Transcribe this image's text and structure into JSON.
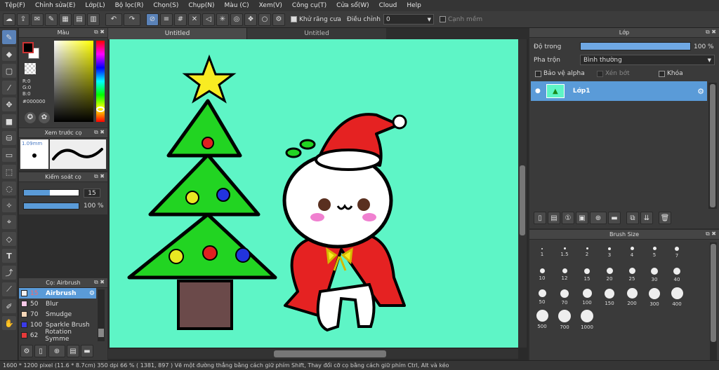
{
  "menu": [
    "Tệp(F)",
    "Chỉnh sửa(E)",
    "Lớp(L)",
    "Bộ lọc(R)",
    "Chọn(S)",
    "Chụp(N)",
    "Màu (C)",
    "Xem(V)",
    "Công cụ(T)",
    "Cửa sổ(W)",
    "Cloud",
    "Help"
  ],
  "toolbar": {
    "anti_alias_label": "Khử răng cưa",
    "adjust_label": "Điều chỉnh",
    "adjust_value": "0",
    "smooth_edge_label": "Cạnh mềm"
  },
  "color_panel": {
    "title": "Màu",
    "r": "R:0",
    "g": "G:0",
    "b": "B:0",
    "hex": "#000000"
  },
  "brush_preview": {
    "title": "Xem trước cọ",
    "size": "1.09mm"
  },
  "brush_control": {
    "title": "Kiểm soát cọ",
    "size_value": "15",
    "opacity_value": "100 %",
    "size_fraction": 0.48,
    "opacity_fraction": 1.0
  },
  "brush_list": {
    "title": "Cọ: Airbrush",
    "items": [
      {
        "size": "15",
        "name": "Airbrush",
        "color": "#f2f2f2",
        "selected": true
      },
      {
        "size": "50",
        "name": "Blur",
        "color": "#f7c8e8",
        "selected": false
      },
      {
        "size": "70",
        "name": "Smudge",
        "color": "#f6d7b8",
        "selected": false
      },
      {
        "size": "100",
        "name": "Sparkle Brush",
        "color": "#3a3ae8",
        "selected": false
      },
      {
        "size": "62",
        "name": "Rotation Symme",
        "color": "#e83a3a",
        "selected": false
      }
    ]
  },
  "tabs": [
    {
      "label": "Untitled",
      "active": true
    },
    {
      "label": "Untitled",
      "active": false
    }
  ],
  "layer_panel": {
    "title": "Lớp",
    "opacity_label": "Độ trong",
    "opacity_value": "100 %",
    "blend_label": "Pha trộn",
    "blend_value": "Bình thường",
    "protect_alpha": "Bảo vệ alpha",
    "clipping": "Xén bớt",
    "lock": "Khóa",
    "layer_name": "Lớp1"
  },
  "brush_size_panel": {
    "title": "Brush Size",
    "sizes": [
      "1",
      "1.5",
      "2",
      "3",
      "4",
      "5",
      "7",
      "10",
      "12",
      "15",
      "20",
      "25",
      "30",
      "40",
      "50",
      "70",
      "100",
      "150",
      "200",
      "300",
      "400",
      "500",
      "700",
      "1000"
    ]
  },
  "status": {
    "text": "1600 * 1200 pixel   (11.6 * 8.7cm)   350 dpi   66 %   ( 1381, 897 )   Vẽ một đường thẳng bằng cách giữ phím Shift, Thay đổi cỡ cọ bằng cách giữ phím Ctrl, Alt và kéo"
  },
  "colors": {
    "canvas_bg": "#5ef5c6",
    "accent": "#5a9bd8"
  }
}
